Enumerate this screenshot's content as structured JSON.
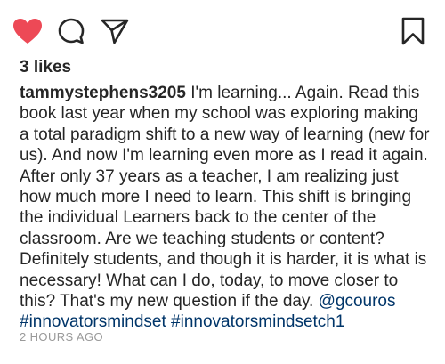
{
  "post": {
    "actions": {
      "like_icon": "heart-filled-icon",
      "comment_icon": "comment-bubble-icon",
      "share_icon": "paper-plane-icon",
      "save_icon": "bookmark-icon",
      "like_color": "#ed4956"
    },
    "likes": "3 likes",
    "caption": {
      "username": "tammystephens3205",
      "text": " I'm learning... Again. Read this book last year when my school was exploring making a total paradigm shift to a new way of learning (new for us). And now I'm learning even more as I read it again. After only 37 years as a teacher, I am realizing just how much more I need to learn. This shift is bringing the individual Learners back to the center of the classroom. Are we teaching students or content? Definitely students, and though it is harder, it is what is necessary! What can I do, today, to move closer to this? That's my new question if the day. ",
      "mention": "@gcouros",
      "hashtag_1": "#innovatorsmindset",
      "hashtag_2": "#innovatorsmindsetch1"
    },
    "timestamp": "2 HOURS AGO"
  }
}
